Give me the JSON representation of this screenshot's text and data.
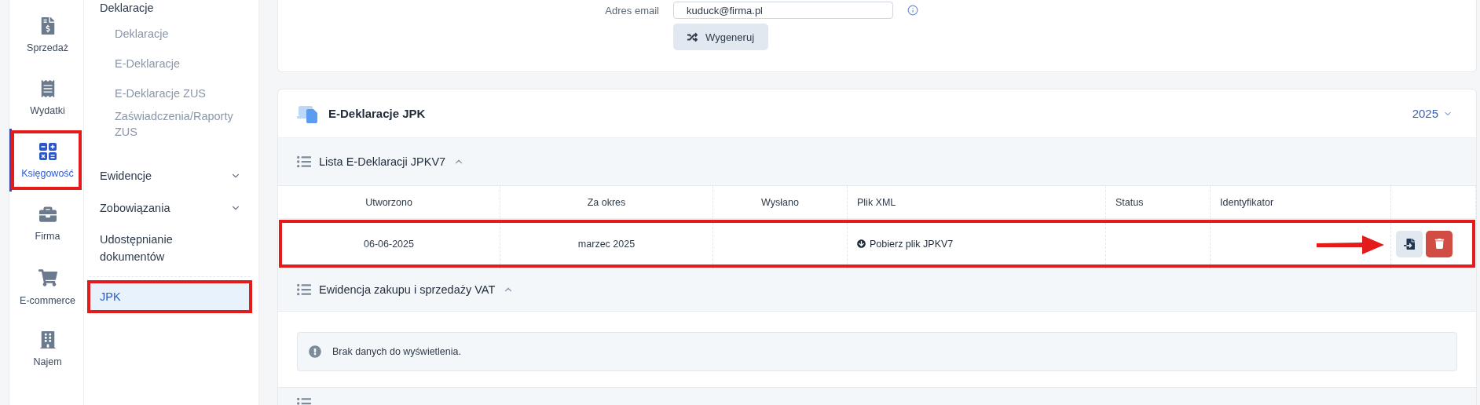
{
  "nav_rail": [
    {
      "label": "Sprzedaż",
      "selected": false,
      "highlighted": false
    },
    {
      "label": "Wydatki",
      "selected": false,
      "highlighted": false
    },
    {
      "label": "Księgowość",
      "selected": true,
      "highlighted": true
    },
    {
      "label": "Firma",
      "selected": false,
      "highlighted": false
    },
    {
      "label": "E-commerce",
      "selected": false,
      "highlighted": false
    },
    {
      "label": "Najem",
      "selected": false,
      "highlighted": false
    }
  ],
  "submenu": [
    {
      "kind": "group",
      "label": "Deklaracje",
      "expanded": true,
      "children": [
        {
          "label": "Deklaracje"
        },
        {
          "label": "E-Deklaracje"
        },
        {
          "label": "E-Deklaracje ZUS"
        },
        {
          "label": "Zaświadczenia/Raporty ZUS"
        }
      ]
    },
    {
      "kind": "group",
      "label": "Ewidencje",
      "expanded": false
    },
    {
      "kind": "group",
      "label": "Zobowiązania",
      "expanded": false
    },
    {
      "kind": "link",
      "label": "Udostępnianie dokumentów",
      "selected": false,
      "highlighted": false
    },
    {
      "kind": "link",
      "label": "JPK",
      "selected": true,
      "highlighted": true
    }
  ],
  "top_form": {
    "email_label": "Adres email",
    "email_value": "kuduck@firma.pl",
    "generate_button": "Wygeneruj"
  },
  "section": {
    "title": "E-Deklaracje JPK",
    "year": "2025",
    "subsections": [
      {
        "kind": "table",
        "title": "Lista E-Deklaracji JPKV7",
        "expanded": true,
        "columns": [
          "Utworzono",
          "Za okres",
          "Wysłano",
          "Plik XML",
          "Status",
          "Identyfikator"
        ],
        "rows": [
          {
            "created": "06-06-2025",
            "period": "marzec 2025",
            "xml_link": "Pobierz plik JPKV7",
            "highlighted": true
          }
        ]
      },
      {
        "kind": "empty",
        "title": "Ewidencja zakupu i sprzedaży VAT",
        "expanded": true,
        "message": "Brak danych do wyświetlenia."
      },
      {
        "kind": "header"
      }
    ]
  }
}
